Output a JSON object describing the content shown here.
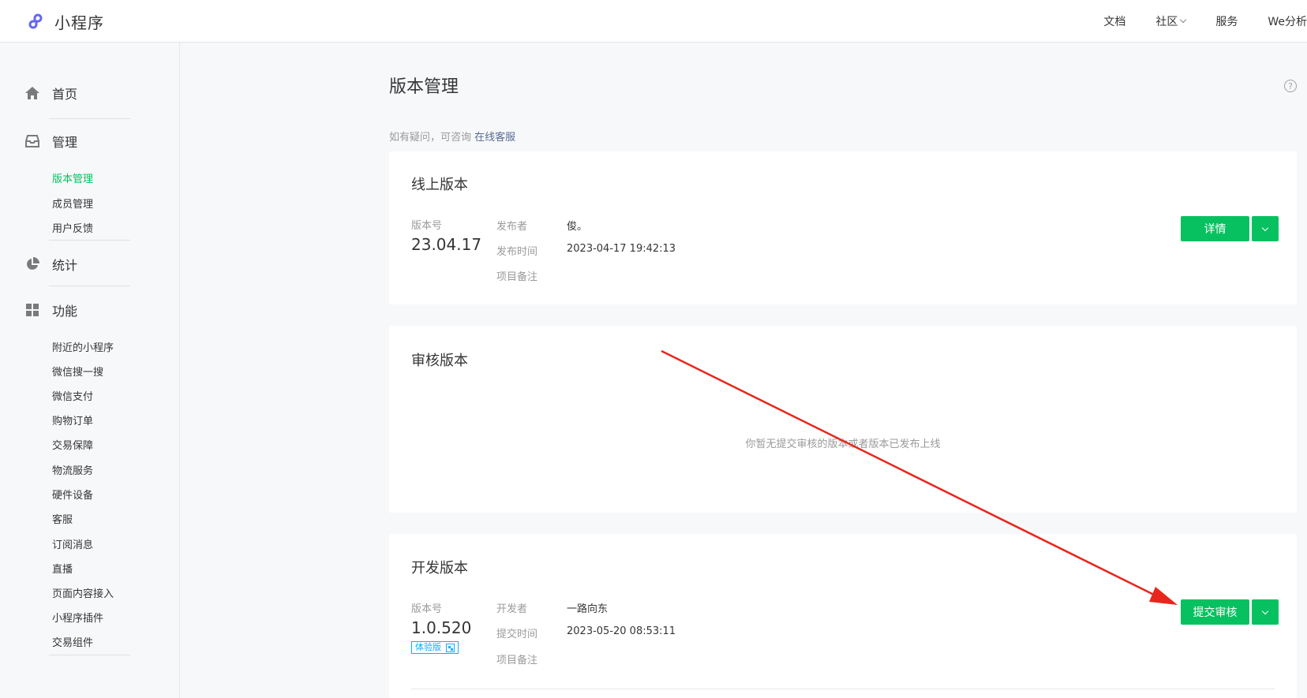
{
  "header": {
    "logo_text": "小程序",
    "nav": [
      {
        "label": "文档"
      },
      {
        "label": "社区",
        "has_dropdown": true
      },
      {
        "label": "服务"
      },
      {
        "label": "We分析"
      }
    ]
  },
  "sidebar": {
    "groups": {
      "home": {
        "label": "首页",
        "icon": "home-icon"
      },
      "manage": {
        "label": "管理",
        "icon": "inbox-icon"
      },
      "stats": {
        "label": "统计",
        "icon": "pie-chart-icon"
      },
      "features": {
        "label": "功能",
        "icon": "grid-icon"
      }
    },
    "manage_items": [
      {
        "label": "版本管理",
        "active": true
      },
      {
        "label": "成员管理"
      },
      {
        "label": "用户反馈"
      }
    ],
    "feature_items": [
      {
        "label": "附近的小程序"
      },
      {
        "label": "微信搜一搜"
      },
      {
        "label": "微信支付"
      },
      {
        "label": "购物订单"
      },
      {
        "label": "交易保障"
      },
      {
        "label": "物流服务"
      },
      {
        "label": "硬件设备"
      },
      {
        "label": "客服"
      },
      {
        "label": "订阅消息"
      },
      {
        "label": "直播"
      },
      {
        "label": "页面内容接入"
      },
      {
        "label": "小程序插件"
      },
      {
        "label": "交易组件"
      }
    ]
  },
  "main": {
    "title": "版本管理",
    "help_symbol": "?",
    "consult_prefix": "如有疑问，可咨询",
    "consult_link": "在线客服",
    "online": {
      "title": "线上版本",
      "version_label": "版本号",
      "version": "23.04.17",
      "publisher_label": "发布者",
      "publisher": "俊。",
      "time_label": "发布时间",
      "time": "2023-04-17 19:42:13",
      "note_label": "项目备注",
      "button": "详情"
    },
    "review": {
      "title": "审核版本",
      "empty": "你暂无提交审核的版本或者版本已发布上线"
    },
    "dev": {
      "title": "开发版本",
      "version_label": "版本号",
      "version": "1.0.520",
      "badge": "体验版",
      "developer_label": "开发者",
      "developer": "一路向东",
      "time_label": "提交时间",
      "time": "2023-05-20 08:53:11",
      "note_label": "项目备注",
      "button": "提交审核"
    }
  },
  "colors": {
    "brand_green": "#07c160",
    "link_blue": "#576b95",
    "badge_blue": "#10aeff",
    "annotation_red": "#e8261c"
  }
}
